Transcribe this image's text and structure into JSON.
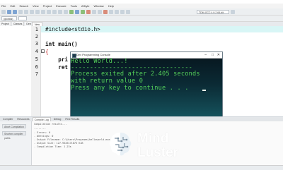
{
  "menu": {
    "items": [
      "File",
      "Edit",
      "Search",
      "View",
      "Project",
      "Execute",
      "Tools",
      "AStyle",
      "Window",
      "Help"
    ]
  },
  "toolbar": {
    "globals_select": "(globals)",
    "compiler_select": "TDM-GCC 4.9.2 64-bit Release"
  },
  "left_panel": {
    "tabs": [
      "Project",
      "Classes",
      "Debug"
    ]
  },
  "editor": {
    "tab_label": "New",
    "lines": [
      {
        "num": "1",
        "code": "#include<stdio.h>"
      },
      {
        "num": "2",
        "code": ""
      },
      {
        "num": "3",
        "code": "int main()"
      },
      {
        "num": "4",
        "code": "{"
      },
      {
        "num": "5",
        "code": "    pri"
      },
      {
        "num": "6",
        "code": "    ret"
      },
      {
        "num": "7",
        "code": ""
      }
    ]
  },
  "console": {
    "title": "Dev Programming Console",
    "lines": [
      "Hello World...!",
      "--------------------------------",
      "Process exited after 2.405 seconds",
      "with return value 0",
      "Press any key to continue . . ."
    ],
    "text_color": "#54d05a"
  },
  "bottom": {
    "tabs": [
      "Compiler",
      "Resources",
      "Compile Log",
      "Debug",
      "Find Results"
    ],
    "side_buttons": [
      "Abort Compilation",
      "Shorten compiler paths"
    ],
    "log_lines": [
      "Compilation results...",
      "--------",
      "- Errors: 0",
      "- Warnings: 0",
      "- Output Filename: C:\\Users\\Programs\\helloworld.exe",
      "- Output Size: 127.9326171875 KiB",
      "- Compilation Time: 1.23s"
    ]
  },
  "watermark": {
    "line1": "Mind",
    "line2": "Luster"
  }
}
